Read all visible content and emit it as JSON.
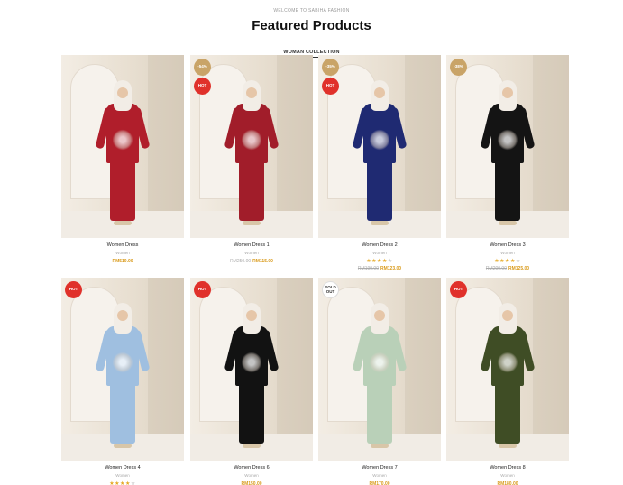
{
  "header": {
    "welcome": "WELCOME TO SABIHA FASHION",
    "title": "Featured Products",
    "collection_tab": "WOMAN COLLECTION"
  },
  "colors": {
    "sale_badge": "#c9a468",
    "hot_badge": "#e0312b",
    "price": "#d99a1a",
    "stars": "#e5a823"
  },
  "products": [
    {
      "name": "Women Dress",
      "category": "Women",
      "badges": [],
      "rating": null,
      "old_price": "",
      "price": "RM510.00",
      "dress_color": "#b01e2b",
      "embroidery": true
    },
    {
      "name": "Women Dress 1",
      "category": "Women",
      "badges": [
        "-54%",
        "HOT"
      ],
      "rating": null,
      "old_price": "RM250.00",
      "price": "RM115.00",
      "dress_color": "#a11d2a",
      "embroidery": true
    },
    {
      "name": "Women Dress 2",
      "category": "Women",
      "badges": [
        "-35%",
        "HOT"
      ],
      "rating": 4,
      "old_price": "RM190.00",
      "price": "RM123.00",
      "dress_color": "#1f2a72",
      "embroidery": true
    },
    {
      "name": "Women Dress 3",
      "category": "Women",
      "badges": [
        "-38%"
      ],
      "rating": 4,
      "old_price": "RM200.00",
      "price": "RM125.00",
      "dress_color": "#141414",
      "embroidery": true
    },
    {
      "name": "Women Dress 4",
      "category": "Women",
      "badges": [
        "HOT"
      ],
      "rating": 4,
      "old_price": "",
      "price": "",
      "dress_color": "#9fbfe0",
      "embroidery": true
    },
    {
      "name": "Women Dress 6",
      "category": "Women",
      "badges": [
        "HOT"
      ],
      "rating": null,
      "old_price": "",
      "price": "RM150.00",
      "dress_color": "#121212",
      "embroidery": true
    },
    {
      "name": "Women Dress 7",
      "category": "Women",
      "badges": [
        "SOLD OUT"
      ],
      "rating": null,
      "old_price": "",
      "price": "RM170.00",
      "dress_color": "#b9d0b8",
      "embroidery": true
    },
    {
      "name": "Women Dress 8",
      "category": "Women",
      "badges": [
        "HOT"
      ],
      "rating": null,
      "old_price": "",
      "price": "RM180.00",
      "dress_color": "#3f4d25",
      "embroidery": true
    }
  ]
}
